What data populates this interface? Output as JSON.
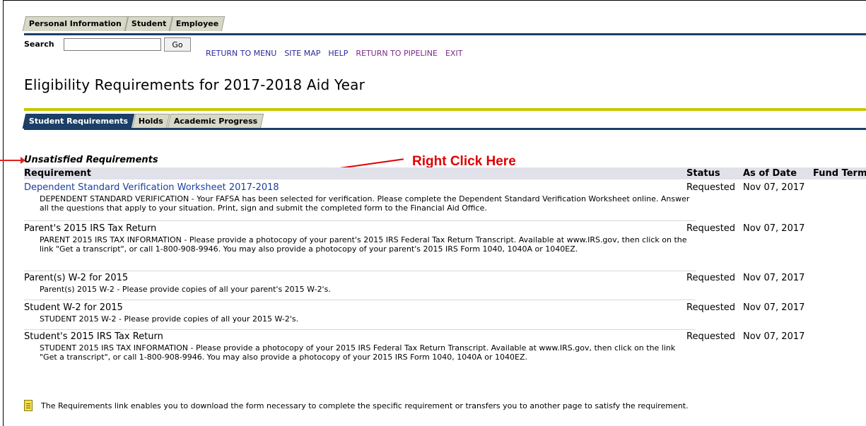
{
  "top_tabs": [
    "Personal Information",
    "Student",
    "Employee"
  ],
  "search": {
    "label": "Search",
    "value": "",
    "go_label": "Go"
  },
  "menu": [
    "RETURN TO MENU",
    "SITE MAP",
    "HELP",
    "RETURN TO PIPELINE",
    "EXIT"
  ],
  "page_title": "Eligibility Requirements for 2017-2018 Aid Year",
  "sub_tabs": [
    "Student Requirements",
    "Holds",
    "Academic Progress"
  ],
  "section_title": "Unsatisfied Requirements",
  "annotation": "Right Click Here",
  "headers": {
    "requirement": "Requirement",
    "status": "Status",
    "as_of_date": "As of Date",
    "fund_term": "Fund Term"
  },
  "requirements": [
    {
      "name": "Dependent Standard Verification Worksheet 2017-2018",
      "link": true,
      "status": "Requested",
      "date": "Nov 07, 2017",
      "desc": "DEPENDENT STANDARD VERIFICATION - Your FAFSA has been selected for verification. Please complete the Dependent Standard Verification Worksheet online. Answer all the questions that apply to your situation. Print, sign and submit the completed form to the Financial Aid Office."
    },
    {
      "name": "Parent's 2015 IRS Tax Return",
      "link": false,
      "status": "Requested",
      "date": "Nov 07, 2017",
      "desc": "PARENT 2015 IRS TAX INFORMATION - Please provide a photocopy of your parent's 2015 IRS Federal Tax Return Transcript. Available at www.IRS.gov, then click on the link \"Get a transcript\", or call 1-800-908-9946. You may also provide a photocopy of your parent's 2015 IRS Form 1040, 1040A or 1040EZ."
    },
    {
      "name": "Parent(s) W-2 for 2015",
      "link": false,
      "status": "Requested",
      "date": "Nov 07, 2017",
      "desc": "Parent(s) 2015 W-2 - Please provide copies of all your parent's 2015 W-2's."
    },
    {
      "name": "Student W-2 for 2015",
      "link": false,
      "status": "Requested",
      "date": "Nov 07, 2017",
      "desc": "STUDENT 2015 W-2 - Please provide copies of all your 2015 W-2's."
    },
    {
      "name": "Student's 2015 IRS Tax Return",
      "link": false,
      "status": "Requested",
      "date": "Nov 07, 2017",
      "desc": "STUDENT 2015 IRS TAX INFORMATION - Please provide a photocopy of your 2015 IRS Federal Tax Return Transcript. Available at www.IRS.gov, then click on the link \"Get a transcript\", or call 1-800-908-9946. You may also provide a photocopy of your 2015 IRS Form 1040, 1040A or 1040EZ."
    }
  ],
  "note": "The Requirements link enables you to download the form necessary to complete the specific requirement or transfers you to another page to satisfy the requirement.",
  "colors": {
    "nav_blue": "#1b3f67",
    "accent_yellow": "#c8c800",
    "annotation_red": "#e00000",
    "link_blue": "#1a3fa0"
  }
}
